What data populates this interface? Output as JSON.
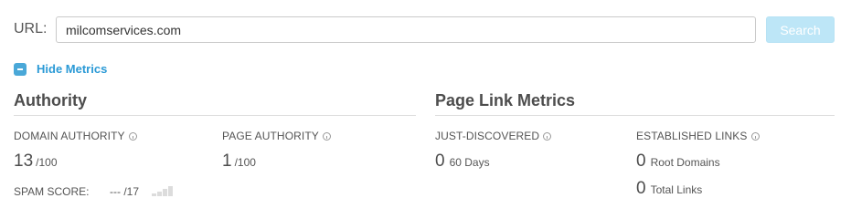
{
  "search": {
    "label": "URL:",
    "value": "milcomservices.com",
    "button_label": "Search"
  },
  "toggle": {
    "label": "Hide Metrics",
    "icon": "minus-square-icon",
    "color": "#2b9ad6"
  },
  "authority": {
    "title": "Authority",
    "domain_authority": {
      "label": "DOMAIN AUTHORITY",
      "value": "13",
      "suffix": "/100"
    },
    "page_authority": {
      "label": "PAGE AUTHORITY",
      "value": "1",
      "suffix": "/100"
    },
    "spam_score": {
      "label": "SPAM SCORE:",
      "value": "--- /17"
    }
  },
  "page_link_metrics": {
    "title": "Page Link Metrics",
    "just_discovered": {
      "label": "JUST-DISCOVERED",
      "value": "0",
      "suffix": "60 Days"
    },
    "established_links": {
      "label": "ESTABLISHED LINKS",
      "root_domains": {
        "value": "0",
        "suffix": "Root Domains"
      },
      "total_links": {
        "value": "0",
        "suffix": "Total Links"
      }
    }
  },
  "colors": {
    "button_bg": "#bde6f7",
    "accent": "#4aa8d8"
  }
}
